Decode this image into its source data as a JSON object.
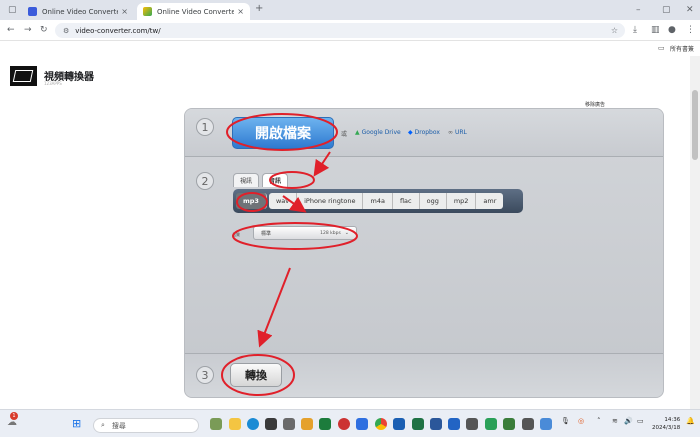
{
  "browser": {
    "tabs": [
      {
        "title": "Online Video Converter_西語",
        "active": false
      },
      {
        "title": "Online Video Converter - 線上",
        "active": true
      }
    ],
    "new_tab": "+",
    "url": "video-converter.com/tw/",
    "bookmarks_label": "所有書簽"
  },
  "site": {
    "brand": "視頻轉換器",
    "brand_sub": "123APPS",
    "ad_label": "移除廣告"
  },
  "steps": {
    "step1_num": "1",
    "step2_num": "2",
    "step3_num": "3",
    "open_file": "開啟檔案",
    "source_or": "或",
    "google_drive": "Google Drive",
    "dropbox": "Dropbox",
    "url": "URL"
  },
  "format": {
    "tabs": [
      "視訊",
      "音訊"
    ],
    "active_tab": "音訊",
    "formats": [
      "mp3",
      "wav",
      "iPhone ringtone",
      "m4a",
      "flac",
      "ogg",
      "mp2",
      "amr"
    ],
    "selected": "mp3",
    "quality_label": "品質",
    "quality_value": "標準",
    "quality_rate": "128 kbps"
  },
  "convert": {
    "label": "轉換"
  },
  "taskbar": {
    "search": "搜尋",
    "notif_count": "1",
    "time": "14:36",
    "date": "2024/3/18"
  },
  "colors": {
    "accent_blue": "#2f7ad0",
    "annotation_red": "#e0202a"
  }
}
